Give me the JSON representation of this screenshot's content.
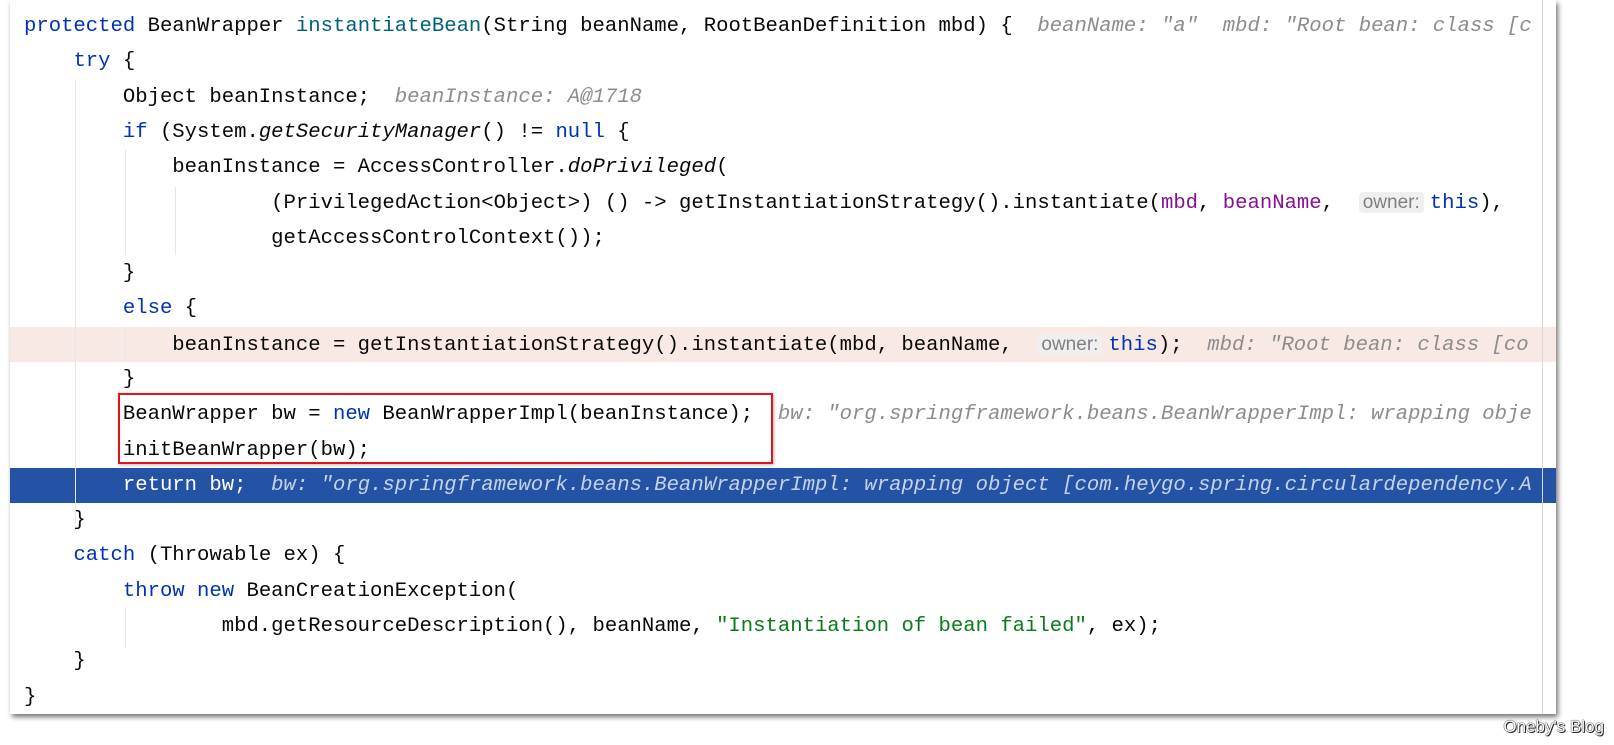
{
  "editor": {
    "colors": {
      "keyword": "#0033b3",
      "method": "#00627a",
      "param": "#871094",
      "string": "#067d17",
      "hint": "#8c8c8c",
      "current_line": "#2453a6",
      "exec_line": "#f9e9e5",
      "highlight_box": "#e0121b"
    },
    "lines": [
      {
        "tokens": [
          [
            "kw",
            "protected "
          ],
          [
            "",
            "BeanWrapper "
          ],
          [
            "fn",
            "instantiateBean"
          ],
          [
            "",
            "(String beanName, RootBeanDefinition mbd) {"
          ],
          [
            "hint",
            "  beanName: \"a\"  mbd: \"Root bean: class [c"
          ]
        ]
      },
      {
        "tokens": [
          [
            "",
            "    "
          ],
          [
            "kw",
            "try"
          ],
          [
            "",
            " {"
          ]
        ]
      },
      {
        "tokens": [
          [
            "",
            "        Object beanInstance;"
          ],
          [
            "hint",
            "  beanInstance: A@1718"
          ]
        ]
      },
      {
        "tokens": [
          [
            "",
            "        "
          ],
          [
            "kw",
            "if"
          ],
          [
            "",
            " (System."
          ],
          [
            "it",
            "getSecurityManager"
          ],
          [
            "",
            "() != "
          ],
          [
            "kw",
            "null"
          ],
          [
            "",
            " {"
          ]
        ]
      },
      {
        "tokens": [
          [
            "",
            "            beanInstance = AccessController."
          ],
          [
            "it",
            "doPrivileged"
          ],
          [
            "",
            "("
          ]
        ]
      },
      {
        "tokens": [
          [
            "",
            "                    (PrivilegedAction<Object>) () -> getInstantiationStrategy().instantiate("
          ],
          [
            "param",
            "mbd"
          ],
          [
            "",
            ", "
          ],
          [
            "param",
            "beanName"
          ],
          [
            "",
            ",  "
          ],
          [
            "inlay",
            "owner:"
          ],
          [
            "kw",
            "this"
          ],
          [
            "",
            "),"
          ]
        ]
      },
      {
        "tokens": [
          [
            "",
            "                    getAccessControlContext());"
          ]
        ]
      },
      {
        "tokens": [
          [
            "",
            "        }"
          ]
        ]
      },
      {
        "tokens": [
          [
            "",
            "        "
          ],
          [
            "kw",
            "else"
          ],
          [
            "",
            " {"
          ]
        ]
      },
      {
        "state": "exec",
        "tokens": [
          [
            "",
            "            beanInstance = getInstantiationStrategy().instantiate(mbd, beanName,  "
          ],
          [
            "inlay",
            "owner:"
          ],
          [
            "kw",
            "this"
          ],
          [
            "",
            ");"
          ],
          [
            "hint",
            "  mbd: \"Root bean: class [co"
          ]
        ]
      },
      {
        "tokens": [
          [
            "",
            "        }"
          ]
        ]
      },
      {
        "tokens": [
          [
            "",
            "        BeanWrapper bw = "
          ],
          [
            "kw",
            "new"
          ],
          [
            "",
            " BeanWrapperImpl(beanInstance);"
          ],
          [
            "hint",
            "  bw: \"org.springframework.beans.BeanWrapperImpl: wrapping obje"
          ]
        ]
      },
      {
        "tokens": [
          [
            "",
            "        initBeanWrapper(bw);"
          ]
        ]
      },
      {
        "state": "current",
        "tokens": [
          [
            "",
            "        "
          ],
          [
            "kw",
            "return"
          ],
          [
            "",
            " bw;"
          ],
          [
            "hint",
            "  bw: \"org.springframework.beans.BeanWrapperImpl: wrapping object [com.heygo.spring.circulardependency.A"
          ]
        ]
      },
      {
        "tokens": [
          [
            "",
            "    }"
          ]
        ]
      },
      {
        "tokens": [
          [
            "",
            "    "
          ],
          [
            "kw",
            "catch"
          ],
          [
            "",
            " (Throwable ex) {"
          ]
        ]
      },
      {
        "tokens": [
          [
            "",
            "        "
          ],
          [
            "kw",
            "throw"
          ],
          [
            "",
            " "
          ],
          [
            "kw",
            "new"
          ],
          [
            "",
            " BeanCreationException("
          ]
        ]
      },
      {
        "tokens": [
          [
            "",
            "                mbd.getResourceDescription(), beanName, "
          ],
          [
            "str",
            "\"Instantiation of bean failed\""
          ],
          [
            "",
            ", ex);"
          ]
        ]
      },
      {
        "tokens": [
          [
            "",
            "    }"
          ]
        ]
      },
      {
        "tokens": [
          [
            "",
            "}"
          ]
        ]
      }
    ]
  },
  "watermark": "Oneby's Blog"
}
